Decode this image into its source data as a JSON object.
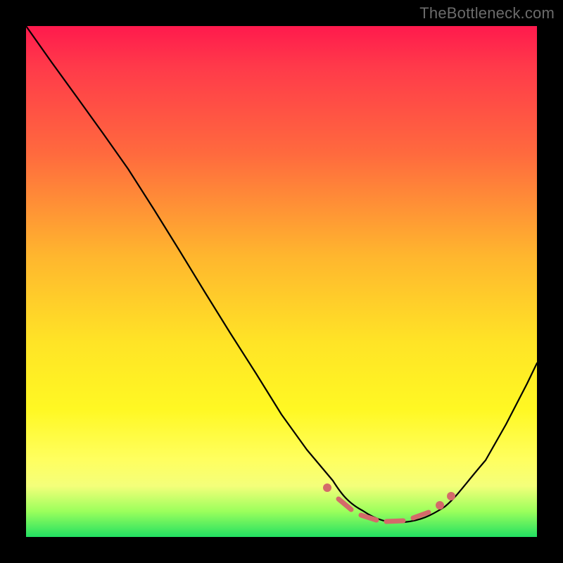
{
  "watermark": "TheBottleneck.com",
  "chart_data": {
    "type": "line",
    "title": "",
    "xlabel": "",
    "ylabel": "",
    "xlim": [
      0,
      100
    ],
    "ylim": [
      0,
      100
    ],
    "grid": false,
    "legend": false,
    "background_gradient": {
      "direction": "vertical",
      "stops": [
        {
          "pos": 0.0,
          "color": "#ff1a4d"
        },
        {
          "pos": 0.25,
          "color": "#ff6a3e"
        },
        {
          "pos": 0.5,
          "color": "#ffd028"
        },
        {
          "pos": 0.75,
          "color": "#fff823"
        },
        {
          "pos": 0.92,
          "color": "#d8ff6a"
        },
        {
          "pos": 1.0,
          "color": "#22e062"
        }
      ]
    },
    "series": [
      {
        "name": "bottleneck-curve",
        "color": "#000000",
        "x": [
          0,
          5,
          10,
          15,
          20,
          25,
          30,
          35,
          40,
          45,
          50,
          55,
          60,
          63,
          66,
          70,
          74,
          78,
          82,
          86,
          90,
          94,
          98,
          100
        ],
        "y": [
          100,
          93,
          86,
          79,
          72,
          64,
          56,
          48,
          40,
          32,
          24,
          17,
          11,
          8,
          6,
          4,
          3,
          3,
          5,
          9,
          15,
          22,
          30,
          34
        ]
      }
    ],
    "annotations": {
      "highlight_region": {
        "description": "red dotted segment at curve minimum",
        "x_range": [
          58,
          82
        ],
        "color": "#d46a6a"
      }
    }
  }
}
